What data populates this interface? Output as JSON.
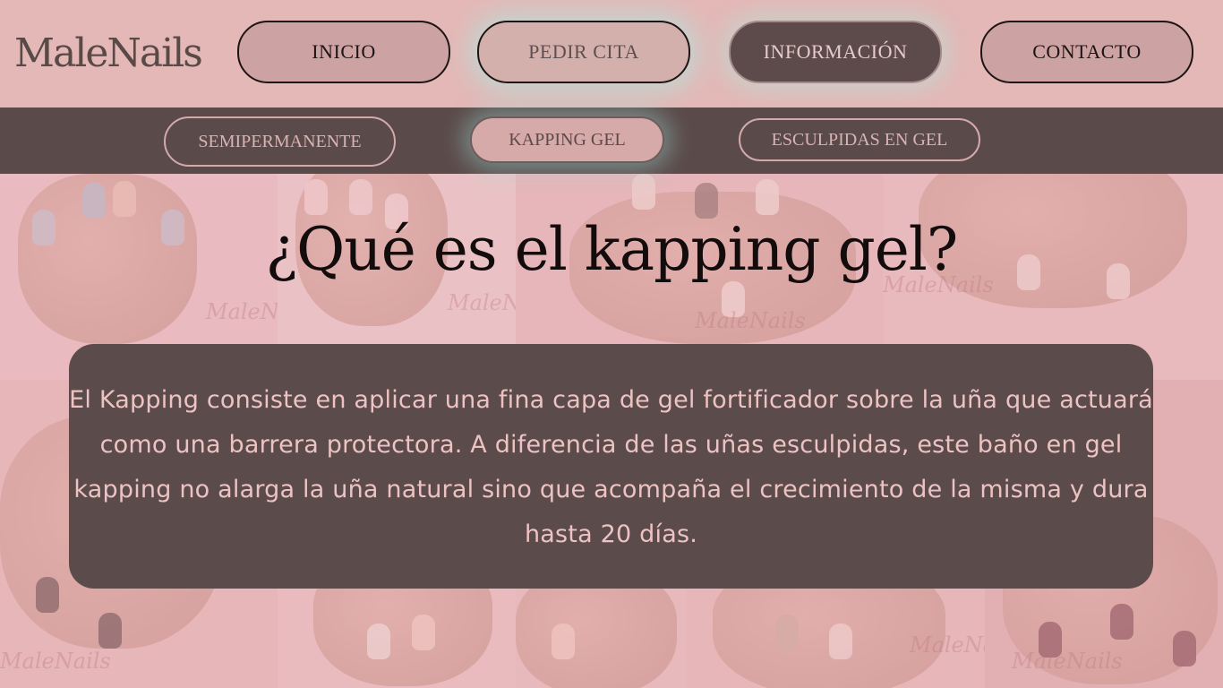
{
  "brand": {
    "logo_text": "MaleNails"
  },
  "nav": {
    "items": [
      {
        "label": "INICIO"
      },
      {
        "label": "PEDIR CITA"
      },
      {
        "label": "INFORMACIÓN"
      },
      {
        "label": "CONTACTO"
      }
    ]
  },
  "subnav": {
    "items": [
      {
        "label": "SEMIPERMANENTE"
      },
      {
        "label": "KAPPING GEL"
      },
      {
        "label": "ESCULPIDAS EN GEL"
      }
    ]
  },
  "content": {
    "title": "¿Qué es el kapping gel?",
    "body": "El Kapping consiste en aplicar una fina capa de gel fortificador sobre la uña que actuará como una barrera protectora. A diferencia de las uñas esculpidas, este baño en gel kapping no alarga la uña natural sino que acompaña el crecimiento de la misma y dura hasta 20 días."
  },
  "watermark": "MaleNails",
  "colors": {
    "header_bg": "#e4b8b7",
    "subnav_bg": "#5b4a4a",
    "card_bg": "#5b4b4b",
    "card_text": "#ecc3c2",
    "glow": "#aaebe1"
  }
}
